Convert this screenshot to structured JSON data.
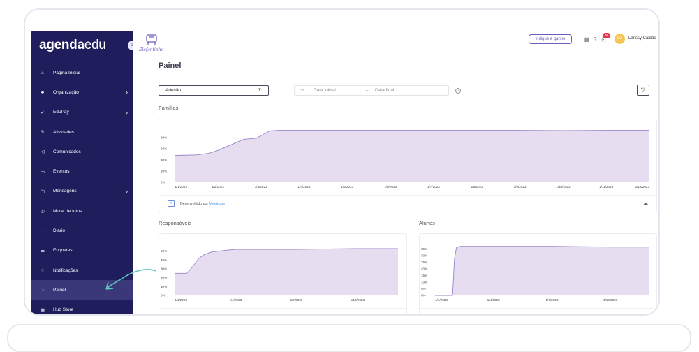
{
  "brand": {
    "name_bold": "agenda",
    "name_light": "edu"
  },
  "school": {
    "name": "Elefantinho"
  },
  "sidebar": {
    "items": [
      {
        "label": "Página Inicial",
        "icon": "home-icon",
        "arrow": false
      },
      {
        "label": "Organização",
        "icon": "org-chart-icon",
        "arrow": true
      },
      {
        "label": "EduPay",
        "icon": "wallet-icon",
        "arrow": true
      },
      {
        "label": "Atividades",
        "icon": "pencil-icon",
        "arrow": false
      },
      {
        "label": "Comunicados",
        "icon": "megaphone-icon",
        "arrow": false
      },
      {
        "label": "Eventos",
        "icon": "calendar-icon",
        "arrow": false
      },
      {
        "label": "Mensagens",
        "icon": "chat-icon",
        "arrow": true
      },
      {
        "label": "Mural de fotos",
        "icon": "camera-icon",
        "arrow": false
      },
      {
        "label": "Diário",
        "icon": "stopwatch-icon",
        "arrow": false
      },
      {
        "label": "Enquetes",
        "icon": "list-icon",
        "arrow": false
      },
      {
        "label": "Notificações",
        "icon": "bell-icon",
        "arrow": false
      },
      {
        "label": "Painel",
        "icon": "gauge-icon",
        "arrow": false,
        "active": true
      },
      {
        "label": "Hub Store",
        "icon": "grid-icon",
        "arrow": false
      }
    ]
  },
  "header": {
    "refer_button": "Indique e ganhe",
    "notification_count": "34",
    "avatar_initials": "LC",
    "user_name": "Larissy Caldas"
  },
  "page": {
    "title": "Painel",
    "filter_select": "Adesão",
    "date_start_placeholder": "Data inicial",
    "date_end_placeholder": "Data final",
    "date_arrow": "→"
  },
  "sections": {
    "families": "Famílias",
    "guardians": "Responsáveis",
    "students": "Alunos"
  },
  "footer": {
    "powered_by": "Desenvolvido por",
    "metabase": "Metabase"
  },
  "colors": {
    "sidebar": "#1f1d5c",
    "area_fill": "#e6def0",
    "area_line": "#9b84c9",
    "accent": "#6b5db8",
    "hint_arrow": "#5cc6bf"
  },
  "chart_data": [
    {
      "type": "area",
      "name": "familias",
      "title": "Famílias",
      "x": [
        "1/1/2023",
        "1/2/2023",
        "1/3/2023",
        "1/4/2023",
        "1/5/2023",
        "1/6/2023",
        "1/7/2023",
        "1/8/2023",
        "1/9/2023",
        "1/10/2023",
        "1/11/2023",
        "1/12/2023"
      ],
      "yticks": [
        "0%",
        "20%",
        "40%",
        "60%",
        "80%"
      ],
      "ylim": [
        0,
        100
      ],
      "points": [
        [
          0,
          48
        ],
        [
          0.5,
          49
        ],
        [
          0.8,
          52
        ],
        [
          1.0,
          57
        ],
        [
          1.3,
          67
        ],
        [
          1.6,
          77
        ],
        [
          1.9,
          79
        ],
        [
          2.2,
          92
        ],
        [
          2.4,
          93
        ],
        [
          4,
          93
        ],
        [
          6,
          93
        ],
        [
          8,
          93
        ],
        [
          9,
          92.5
        ],
        [
          10,
          93
        ],
        [
          11,
          93
        ]
      ]
    },
    {
      "type": "area",
      "name": "responsaveis",
      "title": "Responsáveis",
      "x": [
        "1/1/2023",
        "1/4/2023",
        "1/7/2023",
        "1/10/2023"
      ],
      "yticks": [
        "0%",
        "10%",
        "20%",
        "30%",
        "40%",
        "50%"
      ],
      "ylim": [
        0,
        60
      ],
      "points": [
        [
          0,
          25
        ],
        [
          0.6,
          25
        ],
        [
          0.8,
          30
        ],
        [
          1.0,
          36
        ],
        [
          1.2,
          42
        ],
        [
          1.45,
          46
        ],
        [
          1.8,
          49
        ],
        [
          2.5,
          51
        ],
        [
          3,
          52
        ],
        [
          4,
          52
        ],
        [
          6,
          52
        ],
        [
          9,
          53
        ],
        [
          11,
          53
        ]
      ]
    },
    {
      "type": "area",
      "name": "alunos",
      "title": "Alunos",
      "x": [
        "1/1/2023",
        "1/4/2023",
        "1/7/2023",
        "1/10/2023"
      ],
      "yticks": [
        "0%",
        "5%",
        "10%",
        "15%",
        "20%",
        "25%",
        "30%",
        "35%"
      ],
      "ylim": [
        0,
        40
      ],
      "points": [
        [
          0,
          0
        ],
        [
          0.9,
          0
        ],
        [
          1.0,
          28
        ],
        [
          1.1,
          36
        ],
        [
          1.3,
          37
        ],
        [
          3,
          37
        ],
        [
          6,
          37
        ],
        [
          9,
          36.5
        ],
        [
          11,
          36.5
        ]
      ]
    }
  ]
}
